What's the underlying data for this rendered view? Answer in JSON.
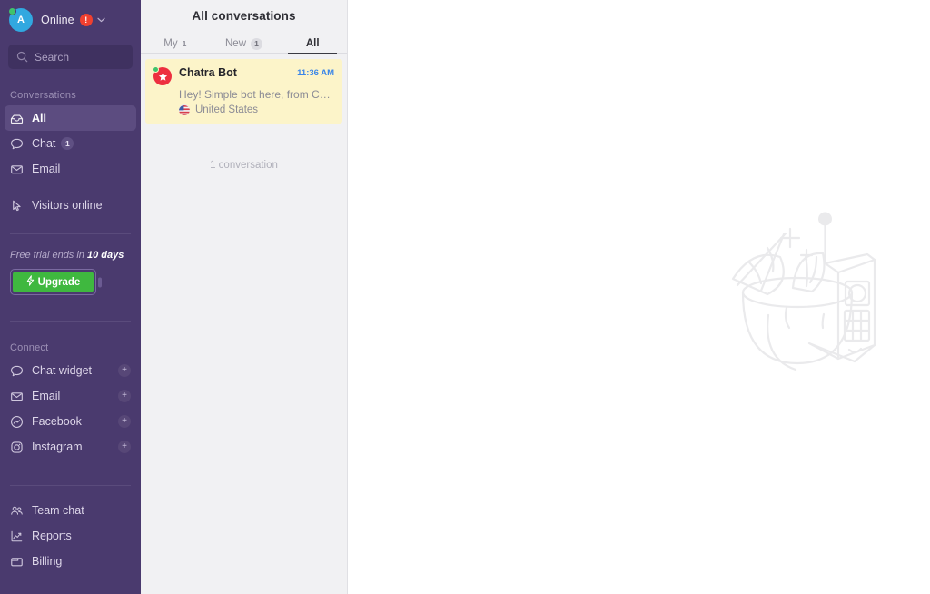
{
  "sidebar": {
    "account": {
      "avatar_initial": "A",
      "status_name": "online-status-dot",
      "label": "Online",
      "alert_badge": "!",
      "chevron": "⌄"
    },
    "search": {
      "placeholder": "Search",
      "icon": "search-icon"
    },
    "conversations_heading": "Conversations",
    "conversation_items": [
      {
        "label": "All",
        "icon": "inbox-icon",
        "badge": "",
        "active": true
      },
      {
        "label": "Chat",
        "icon": "chat-bubble-icon",
        "badge": "1",
        "active": false
      },
      {
        "label": "Email",
        "icon": "envelope-icon",
        "badge": "",
        "active": false
      }
    ],
    "visitors": {
      "label": "Visitors online",
      "icon": "cursor-icon"
    },
    "trial": {
      "text_prefix": "Free trial ends in ",
      "text_bold": "10 days",
      "upgrade_label": "Upgrade",
      "upgrade_icon": "bolt-icon"
    },
    "connect_heading": "Connect",
    "connect_items": [
      {
        "label": "Chat widget",
        "icon": "chat-bubble-icon",
        "plus": "+"
      },
      {
        "label": "Email",
        "icon": "envelope-icon",
        "plus": "+"
      },
      {
        "label": "Facebook",
        "icon": "facebook-messenger-icon",
        "plus": "+"
      },
      {
        "label": "Instagram",
        "icon": "instagram-icon",
        "plus": "+"
      }
    ],
    "bottom_items": [
      {
        "label": "Team chat",
        "icon": "people-icon"
      },
      {
        "label": "Reports",
        "icon": "chart-icon"
      },
      {
        "label": "Billing",
        "icon": "wallet-icon"
      }
    ]
  },
  "conversation_list": {
    "title": "All conversations",
    "tabs": [
      {
        "label": "My",
        "count": "1",
        "badge_style": "plain",
        "active": false
      },
      {
        "label": "New",
        "count": "1",
        "badge_style": "pill",
        "active": false
      },
      {
        "label": "All",
        "count": "",
        "badge_style": "none",
        "active": true
      }
    ],
    "items": [
      {
        "name": "Chatra Bot",
        "time": "11:36 AM",
        "preview": "Hey! Simple bot here, from Chatr...",
        "location": "United States",
        "avatar_icon": "star-icon",
        "status": "online"
      }
    ],
    "footer": "1 conversation"
  },
  "main": {
    "illustration_name": "coconut-drink-and-phone-illustration"
  },
  "colors": {
    "sidebar_bg": "#4a3a6e",
    "sidebar_active": "#5c4c80",
    "list_bg": "#f1f1f3",
    "conversation_highlight": "#fcf4c9",
    "upgrade_green": "#3fb83f",
    "alert_red": "#f0402f",
    "time_blue": "#3b86e8",
    "avatar_red": "#ed2f3f",
    "status_green": "#3fc36b"
  }
}
